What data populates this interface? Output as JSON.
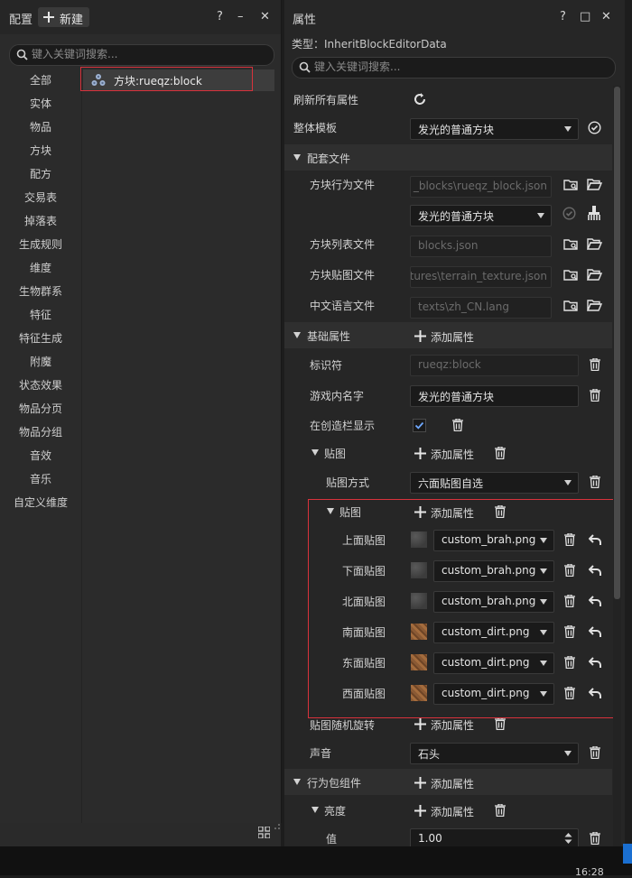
{
  "left_panel": {
    "title": "配置",
    "new_button": "新建",
    "window_controls": [
      "?",
      "–",
      "✕"
    ],
    "search_placeholder": "键入关键词搜索...",
    "categories": [
      "全部",
      "实体",
      "物品",
      "方块",
      "配方",
      "交易表",
      "掉落表",
      "生成规则",
      "维度",
      "生物群系",
      "特征",
      "特征生成",
      "附魔",
      "状态效果",
      "物品分页",
      "物品分组",
      "音效",
      "音乐",
      "自定义维度"
    ],
    "tree_item": "方块:rueqz:block"
  },
  "right_panel": {
    "title": "属性",
    "window_controls": [
      "?",
      "□",
      "✕"
    ],
    "type_text": "类型：InheritBlockEditorData",
    "search_placeholder": "键入关键词搜索...",
    "refresh_label": "刷新所有属性",
    "template_label": "整体模板",
    "template_value": "发光的普通方块",
    "config_section": "配套文件",
    "behavior_file_label": "方块行为文件",
    "behavior_file_value": "_blocks\\rueqz_block.json",
    "behavior_template_value": "发光的普通方块",
    "block_list_label": "方块列表文件",
    "block_list_value": "blocks.json",
    "texture_file_label": "方块贴图文件",
    "texture_file_value": "tures\\terrain_texture.json",
    "lang_file_label": "中文语言文件",
    "lang_file_value": "texts\\zh_CN.lang",
    "basic_section": "基础属性",
    "add_attr": "添加属性",
    "identifier_label": "标识符",
    "identifier_value": "rueqz:block",
    "ingame_name_label": "游戏内名字",
    "ingame_name_value": "发光的普通方块",
    "creative_label": "在创造栏显示",
    "creative_checked": true,
    "texture_group_label": "贴图",
    "texture_mode_label": "贴图方式",
    "texture_mode_value": "六面贴图自选",
    "texture_sub_label": "贴图",
    "faces": [
      {
        "label": "上面贴图",
        "value": "custom_brah.png",
        "thumb": "stone"
      },
      {
        "label": "下面贴图",
        "value": "custom_brah.png",
        "thumb": "stone"
      },
      {
        "label": "北面贴图",
        "value": "custom_brah.png",
        "thumb": "stone"
      },
      {
        "label": "南面贴图",
        "value": "custom_dirt.png",
        "thumb": "dirt"
      },
      {
        "label": "东面贴图",
        "value": "custom_dirt.png",
        "thumb": "dirt"
      },
      {
        "label": "西面贴图",
        "value": "custom_dirt.png",
        "thumb": "dirt"
      }
    ],
    "random_rotation_label": "贴图随机旋转",
    "sound_label": "声音",
    "sound_value": "石头",
    "behavior_pack_section": "行为包组件",
    "brightness_label": "亮度",
    "value_label": "值",
    "value_value": "1.00"
  },
  "clock": "16:28"
}
